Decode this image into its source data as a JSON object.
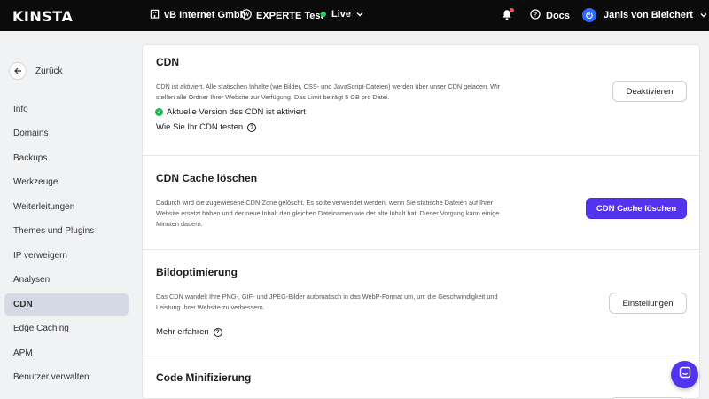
{
  "topbar": {
    "logo": "KINSTA",
    "company": "vB Internet Gmbh",
    "site": "EXPERTE Test",
    "environment": "Live",
    "docs": "Docs",
    "user": "Janis von Bleichert"
  },
  "sidebar": {
    "back_label": "Zurück",
    "items": [
      "Info",
      "Domains",
      "Backups",
      "Werkzeuge",
      "Weiterleitungen",
      "Themes und Plugins",
      "IP verweigern",
      "Analysen",
      "CDN",
      "Edge Caching",
      "APM",
      "Benutzer verwalten"
    ],
    "active": "CDN"
  },
  "sections": {
    "cdn": {
      "title": "CDN",
      "description": "CDN ist aktiviert. Alle statischen Inhalte (wie Bilder, CSS- und JavaScript-Dateien) werden über unser CDN geladen. Wir stellen alle Ordner Ihrer Website zur Verfügung. Das Limit beträgt 5 GB pro Datei.",
      "status": "Aktuelle Version des CDN ist aktiviert",
      "help_link": "Wie Sie Ihr CDN testen",
      "button": "Deaktivieren"
    },
    "cache": {
      "title": "CDN Cache löschen",
      "description": "Dadurch wird die zugewiesene CDN-Zone gelöscht. Es sollte verwendet werden, wenn Sie statische Dateien auf Ihrer Website ersetzt haben und der neue Inhalt den gleichen Dateinamen wie der alte Inhalt hat. Dieser Vorgang kann einige Minuten dauern.",
      "button": "CDN Cache löschen"
    },
    "image": {
      "title": "Bildoptimierung",
      "description": "Das CDN wandelt Ihre PNG-, GIF- und JPEG-Bilder automatisch in das WebP-Format um, um die Geschwindigkeit und Leistung Ihrer Website zu verbessern.",
      "help_link": "Mehr erfahren",
      "button": "Einstellungen"
    },
    "code": {
      "title": "Code Minifizierung"
    }
  },
  "colors": {
    "primary": "#5333ed",
    "live": "#2ec866",
    "success": "#1db954",
    "notification": "#ff4d4f"
  },
  "icons": {
    "company": "building-icon",
    "site": "wordpress-icon",
    "bell": "bell-icon",
    "docs": "help-circle-icon",
    "back": "arrow-left-icon",
    "chat": "chat-icon"
  }
}
